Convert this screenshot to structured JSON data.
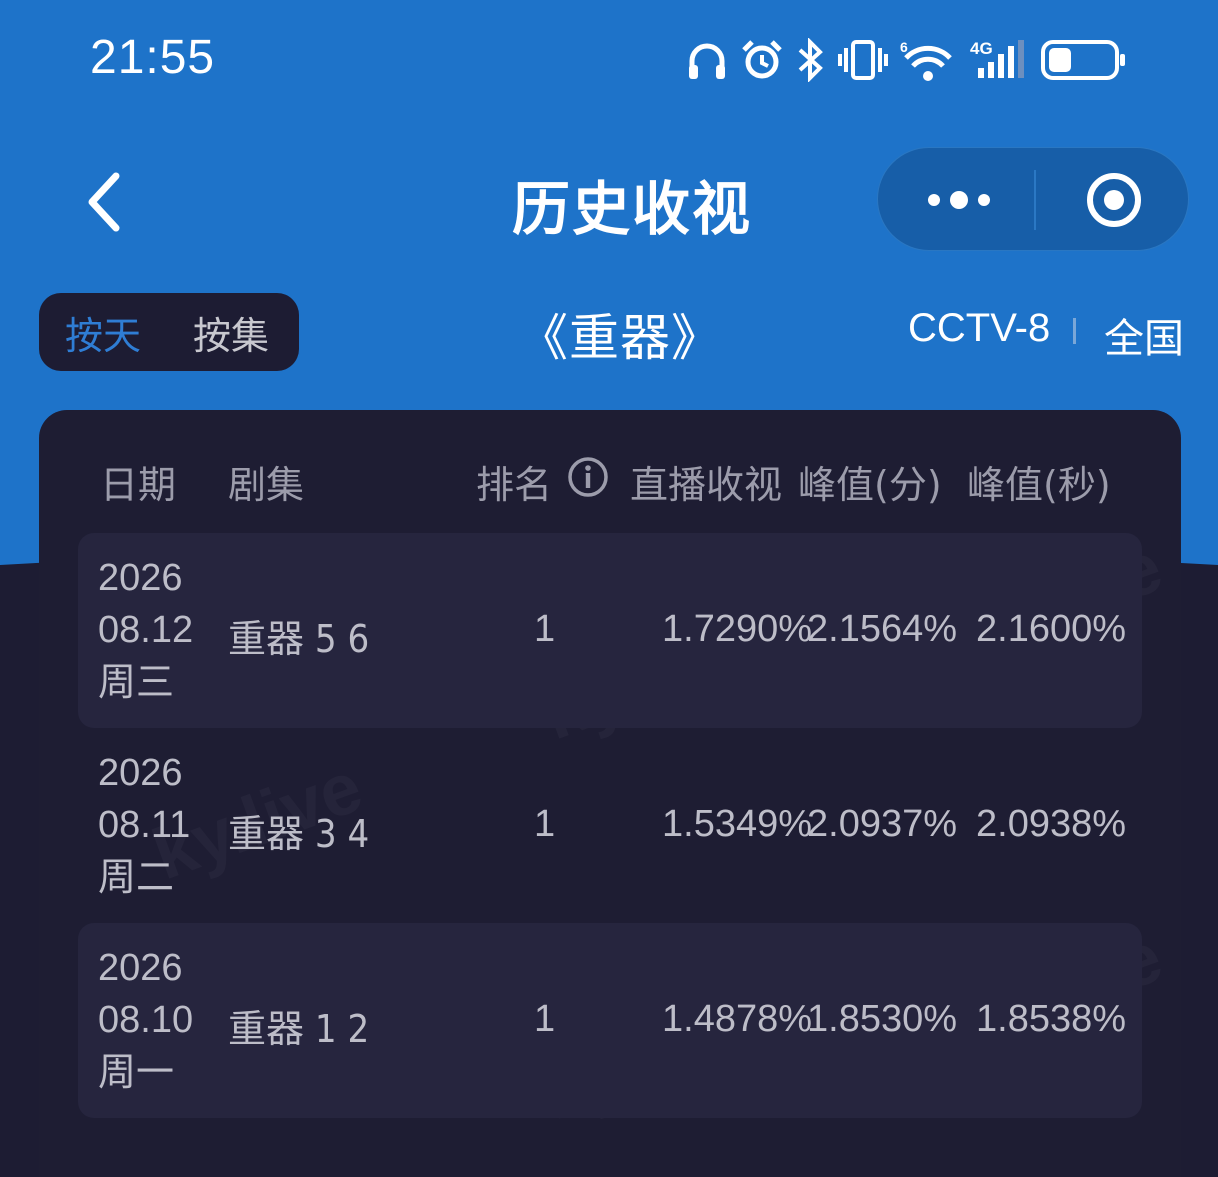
{
  "status_bar": {
    "time": "21:55",
    "icons": [
      "headphones-icon",
      "alarm-icon",
      "bluetooth-icon",
      "vibrate-icon",
      "wifi-icon",
      "signal-icon",
      "battery-icon"
    ],
    "wifi_badge": "6",
    "signal_badge": "4G"
  },
  "nav": {
    "title": "历史收视"
  },
  "filters": {
    "by_day": "按天",
    "by_episode": "按集"
  },
  "show": {
    "title": "《重器》",
    "channel": "CCTV-8",
    "region": "全国"
  },
  "table": {
    "headers": {
      "date": "日期",
      "episode": "剧集",
      "rank": "排名",
      "live_rating": "直播收视",
      "peak_min": "峰值(分)",
      "peak_sec": "峰值(秒)"
    },
    "rows": [
      {
        "year": "2026",
        "date": "08.12",
        "weekday": "周三",
        "episode": "重器 5 6",
        "rank": "1",
        "live": "1.7290%",
        "peak_min": "2.1564%",
        "peak_sec": "2.1600%"
      },
      {
        "year": "2026",
        "date": "08.11",
        "weekday": "周二",
        "episode": "重器 3 4",
        "rank": "1",
        "live": "1.5349%",
        "peak_min": "2.0937%",
        "peak_sec": "2.0938%"
      },
      {
        "year": "2026",
        "date": "08.10",
        "weekday": "周一",
        "episode": "重器 1 2",
        "rank": "1",
        "live": "1.4878%",
        "peak_min": "1.8530%",
        "peak_sec": "1.8538%"
      }
    ]
  },
  "watermark": "ky.live",
  "colors": {
    "header_blue": "#1e73c9",
    "page_dark": "#1d1c33",
    "active_tab": "#2f7dd4"
  }
}
